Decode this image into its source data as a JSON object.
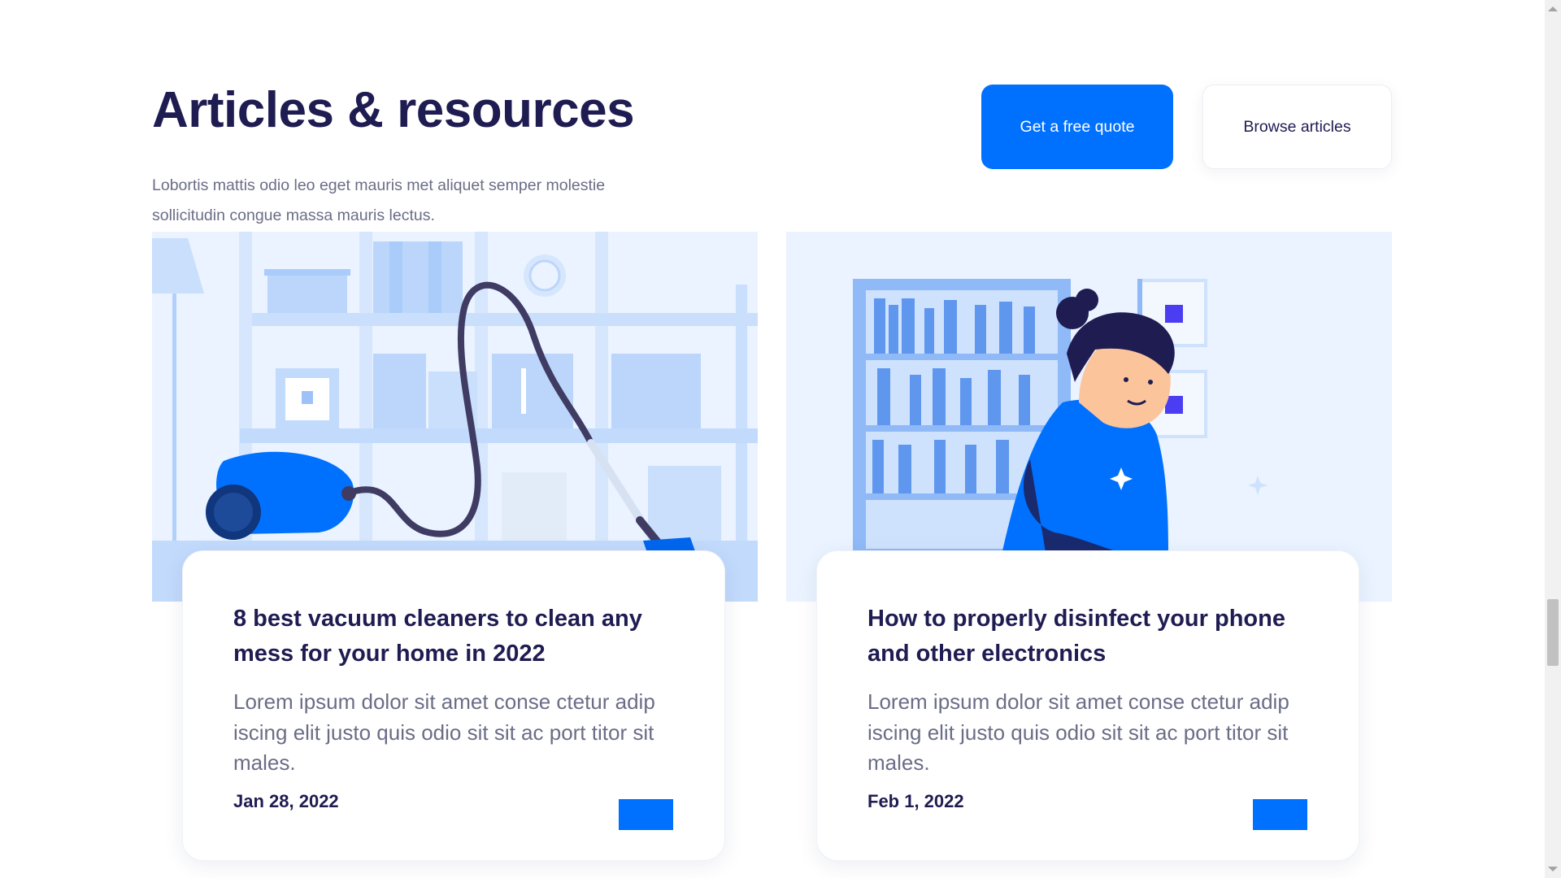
{
  "section": {
    "title": "Articles & resources",
    "subtitle": "Lobortis mattis odio leo eget mauris met aliquet semper molestie sollicitudin congue massa mauris lectus."
  },
  "buttons": {
    "primary_label": "Get a free quote",
    "secondary_label": "Browse articles"
  },
  "articles": [
    {
      "title": "8 best vacuum cleaners to clean any mess for your home in 2022",
      "excerpt": "Lorem ipsum dolor sit amet conse ctetur adip iscing elit justo quis odio sit sit ac port titor sit males.",
      "date": "Jan 28, 2022",
      "illustration": "vacuum-cleaner-illustration"
    },
    {
      "title": "How to properly disinfect your phone and other electronics",
      "excerpt": "Lorem ipsum dolor sit amet conse ctetur adip iscing elit justo quis odio sit sit ac port titor sit males.",
      "date": "Feb 1, 2022",
      "illustration": "person-cleaning-illustration"
    }
  ],
  "colors": {
    "accent": "#0071ff",
    "heading": "#1f1c52",
    "body_text": "#6a6d86",
    "illustration_bg": "#eaf3ff"
  }
}
